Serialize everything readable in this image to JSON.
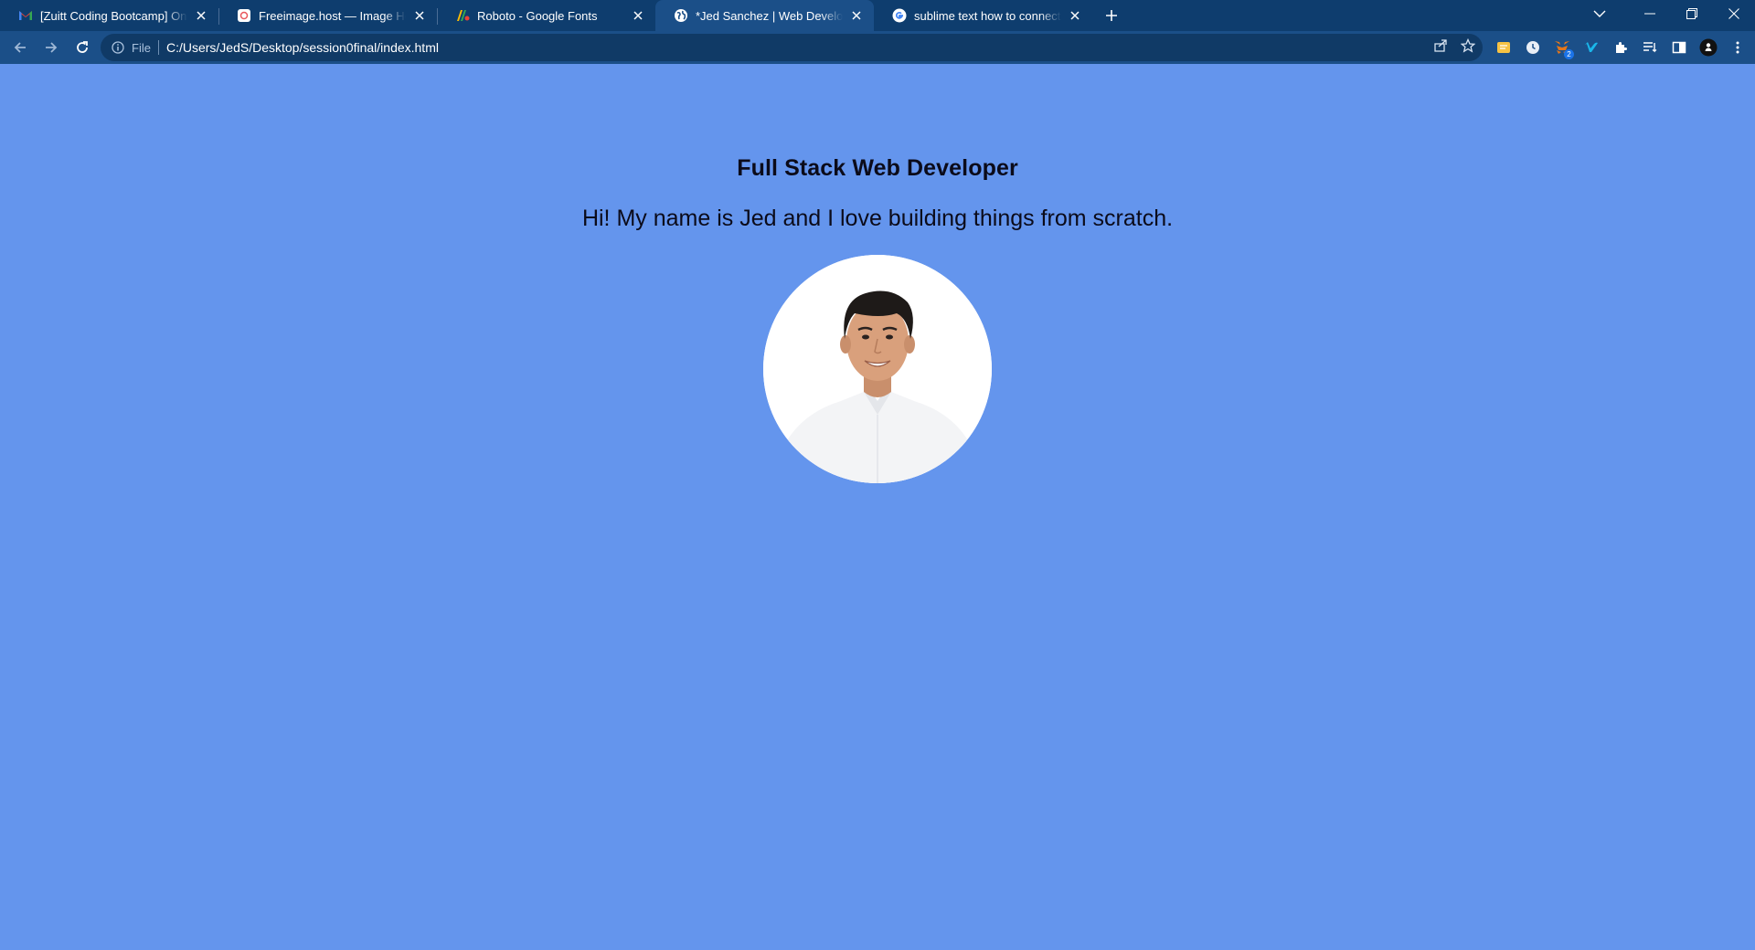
{
  "browser": {
    "tabs": [
      {
        "title": "[Zuitt Coding Bootcamp] Online",
        "icon": "gmail-icon",
        "active": false
      },
      {
        "title": "Freeimage.host — Image Hosting",
        "icon": "freeimage-icon",
        "active": false
      },
      {
        "title": "Roboto - Google Fonts",
        "icon": "google-fonts-icon",
        "active": false
      },
      {
        "title": "*Jed Sanchez | Web Developer Po",
        "icon": "globe-icon",
        "active": true
      },
      {
        "title": "sublime text how to connect css",
        "icon": "google-icon",
        "active": false
      }
    ],
    "address": {
      "scheme": "File",
      "url": "C:/Users/JedS/Desktop/session0final/index.html"
    },
    "extension_badge": "2"
  },
  "page": {
    "headline": "Full Stack Web Developer",
    "intro": "Hi! My name is Jed and I love building things from scratch.",
    "portrait_alt": "portrait-photo"
  },
  "colors": {
    "page_background": "#6495ed",
    "tab_strip": "#0e3d6e",
    "toolbar": "#1b4f88"
  }
}
